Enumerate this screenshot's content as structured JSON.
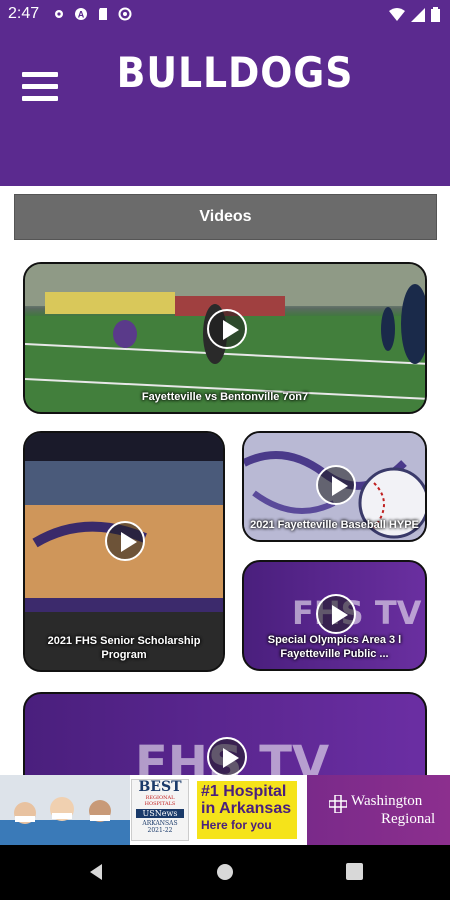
{
  "status_bar": {
    "time": "2:47"
  },
  "header": {
    "logo_text": "BULLDOGS"
  },
  "section": {
    "title": "Videos"
  },
  "videos": [
    {
      "caption": "Fayetteville vs Bentonville 7on7"
    },
    {
      "caption": "2021 FHS Senior Scholarship Program"
    },
    {
      "caption": "2021 Fayetteville Baseball HYPE"
    },
    {
      "caption": "Special Olympics Area 3 l Fayetteville Public ..."
    },
    {
      "caption": ""
    }
  ],
  "fhs_tv_text": "FHS TV",
  "ad": {
    "best_lines": [
      "BEST",
      "REGIONAL HOSPITALS",
      "USNews",
      "ARKANSAS",
      "2021-22"
    ],
    "headline_1": "#1 Hospital",
    "headline_2": "in Arkansas",
    "sub": "Here for you",
    "brand_1": "Washington",
    "brand_2": "Regional"
  },
  "colors": {
    "brand_purple": "#5b2a8f",
    "section_gray": "#6b6b6b",
    "ad_yellow": "#f5e31a"
  }
}
